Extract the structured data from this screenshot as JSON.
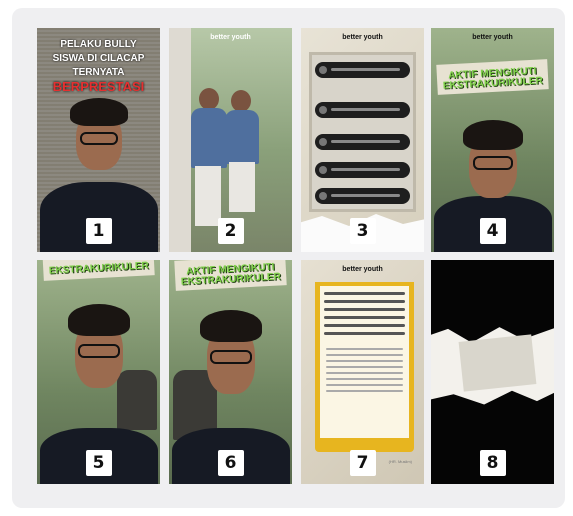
{
  "tiles": [
    {
      "number": "1",
      "headline_line1": "PELAKU BULLY",
      "headline_line2": "SISWA DI CILACAP",
      "headline_line3": "TERNYATA",
      "headline_highlight": "BERPRESTASI"
    },
    {
      "number": "2",
      "logo": "better youth"
    },
    {
      "number": "3",
      "logo": "better youth"
    },
    {
      "number": "4",
      "logo": "better youth",
      "banner": "AKTIF MENGIKUTI EKSTRAKURIKULER"
    },
    {
      "number": "5",
      "banner": "EKSTRAKURIKULER"
    },
    {
      "number": "6",
      "banner": "AKTIF MENGIKUTI EKSTRAKURIKULER"
    },
    {
      "number": "7",
      "logo": "better youth",
      "source": "(HR. Muslim)"
    },
    {
      "number": "8"
    }
  ],
  "colors": {
    "headline_highlight": "#e53030",
    "banner_text": "#7fd04a",
    "quote_frame": "#e7b51f"
  }
}
